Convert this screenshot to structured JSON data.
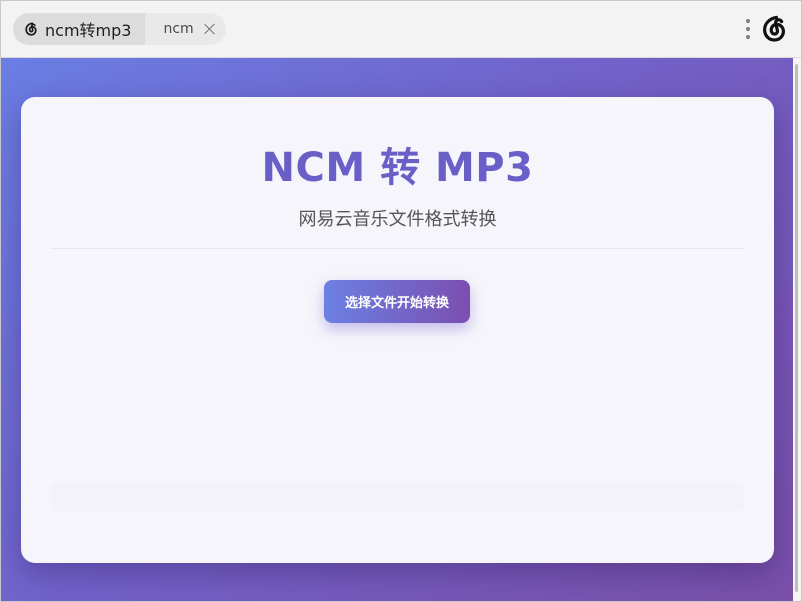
{
  "tabs": [
    {
      "label": "ncm转mp3",
      "icon": "netease-music-icon",
      "active": true
    },
    {
      "label": "ncm",
      "active": false
    }
  ],
  "titlebar": {
    "menu_icon": "kebab-menu-icon",
    "logo_icon": "netease-music-logo-icon"
  },
  "card": {
    "title": "NCM 转 MP3",
    "subtitle": "网易云音乐文件格式转换",
    "button_label": "选择文件开始转换",
    "status_text": ""
  },
  "colors": {
    "accent": "#6a5fc7",
    "gradient_start": "#6a7ee3",
    "gradient_end": "#7a4fa8"
  }
}
